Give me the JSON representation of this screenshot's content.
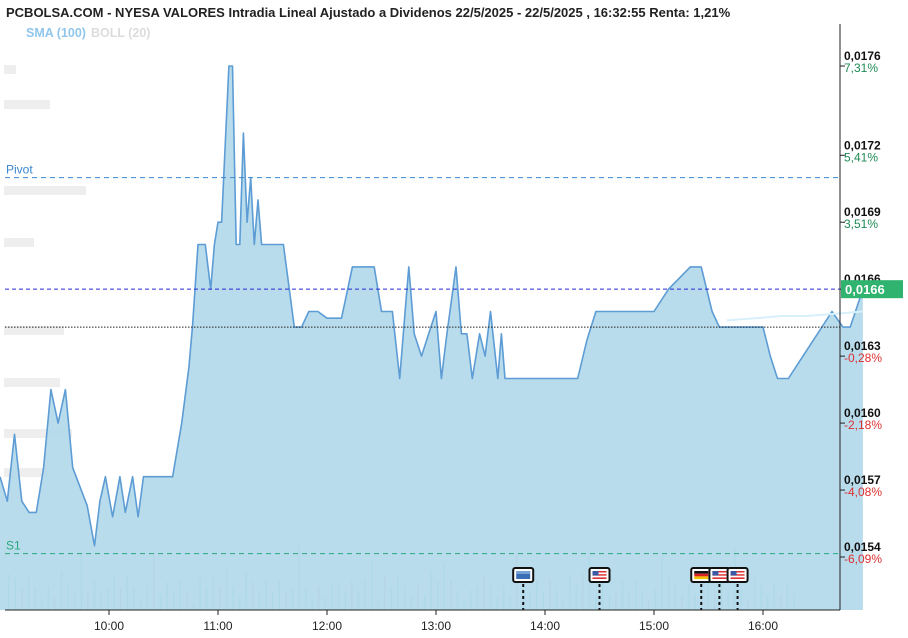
{
  "header": {
    "title": "PCBOLSA.COM - NYESA VALORES Intradia Lineal Ajustado a Dividenos 22/5/2025 - 22/5/2025 , 16:32:55 Renta: 1,21%"
  },
  "legend": {
    "sma": "SMA (100)",
    "boll": "BOLL (20)"
  },
  "colors": {
    "area_fill": "#b0d8ea",
    "line": "#5d9cd4",
    "pivot": "#3b86cf",
    "s1": "#2aa779",
    "current": "#2929d6",
    "positive": "#1e8a55",
    "negative": "#dc3030",
    "badge": "#2fb36f"
  },
  "chart_data": {
    "type": "area",
    "xlabel": "",
    "ylabel": "",
    "ylim": [
      0.01525,
      0.0178
    ],
    "x_ticks": [
      "10:00",
      "11:00",
      "12:00",
      "13:00",
      "14:00",
      "15:00",
      "16:00"
    ],
    "y_ticks": [
      {
        "price": "0,0176",
        "pct": "7,31%",
        "value": 0.0176
      },
      {
        "price": "0,0172",
        "pct": "5,41%",
        "value": 0.0172
      },
      {
        "price": "0,0169",
        "pct": "3,51%",
        "value": 0.0169
      },
      {
        "price": "0,0166",
        "pct": "1,62%",
        "value": 0.0166
      },
      {
        "price": "0,0163",
        "pct": "-0,28%",
        "value": 0.0163
      },
      {
        "price": "0,0160",
        "pct": "-2,18%",
        "value": 0.016
      },
      {
        "price": "0,0157",
        "pct": "-4,08%",
        "value": 0.0157
      },
      {
        "price": "0,0154",
        "pct": "-6,09%",
        "value": 0.0154
      }
    ],
    "series": [
      {
        "values": [
          [
            "09:00",
            0.01576
          ],
          [
            "09:04",
            0.01565
          ],
          [
            "09:08",
            0.01595
          ],
          [
            "09:12",
            0.01565
          ],
          [
            "09:16",
            0.0156
          ],
          [
            "09:20",
            0.0156
          ],
          [
            "09:24",
            0.0158
          ],
          [
            "09:28",
            0.01615
          ],
          [
            "09:32",
            0.016
          ],
          [
            "09:36",
            0.01615
          ],
          [
            "09:40",
            0.0158
          ],
          [
            "09:48",
            0.01563
          ],
          [
            "09:52",
            0.01545
          ],
          [
            "09:55",
            0.01565
          ],
          [
            "09:58",
            0.01576
          ],
          [
            "10:02",
            0.01558
          ],
          [
            "10:06",
            0.01576
          ],
          [
            "10:09",
            0.0156
          ],
          [
            "10:13",
            0.01576
          ],
          [
            "10:16",
            0.01558
          ],
          [
            "10:19",
            0.01576
          ],
          [
            "10:22",
            0.01576
          ],
          [
            "10:35",
            0.01576
          ],
          [
            "10:40",
            0.016
          ],
          [
            "10:44",
            0.01625
          ],
          [
            "10:46",
            0.01644
          ],
          [
            "10:49",
            0.0168
          ],
          [
            "10:53",
            0.0168
          ],
          [
            "10:56",
            0.0166
          ],
          [
            "10:58",
            0.0168
          ],
          [
            "11:00",
            0.0169
          ],
          [
            "11:02",
            0.0169
          ],
          [
            "11:06",
            0.0176
          ],
          [
            "11:08",
            0.0176
          ],
          [
            "11:10",
            0.0168
          ],
          [
            "11:12",
            0.0168
          ],
          [
            "11:14",
            0.0173
          ],
          [
            "11:16",
            0.0169
          ],
          [
            "11:18",
            0.0171
          ],
          [
            "11:20",
            0.0168
          ],
          [
            "11:22",
            0.017
          ],
          [
            "11:24",
            0.0168
          ],
          [
            "11:36",
            0.0168
          ],
          [
            "11:42",
            0.01643
          ],
          [
            "11:46",
            0.01643
          ],
          [
            "11:50",
            0.0165
          ],
          [
            "11:55",
            0.0165
          ],
          [
            "12:00",
            0.01647
          ],
          [
            "12:02",
            0.01647
          ],
          [
            "12:08",
            0.01647
          ],
          [
            "12:14",
            0.0167
          ],
          [
            "12:20",
            0.0167
          ],
          [
            "12:26",
            0.0167
          ],
          [
            "12:30",
            0.0165
          ],
          [
            "12:36",
            0.0165
          ],
          [
            "12:40",
            0.0162
          ],
          [
            "12:43",
            0.0165
          ],
          [
            "12:45",
            0.0167
          ],
          [
            "12:48",
            0.0164
          ],
          [
            "12:52",
            0.0163
          ],
          [
            "12:56",
            0.0164
          ],
          [
            "13:00",
            0.0165
          ],
          [
            "13:03",
            0.0162
          ],
          [
            "13:06",
            0.0164
          ],
          [
            "13:11",
            0.0167
          ],
          [
            "13:14",
            0.0164
          ],
          [
            "13:17",
            0.0164
          ],
          [
            "13:20",
            0.0162
          ],
          [
            "13:24",
            0.0164
          ],
          [
            "13:27",
            0.0163
          ],
          [
            "13:30",
            0.0165
          ],
          [
            "13:34",
            0.0162
          ],
          [
            "13:36",
            0.0164
          ],
          [
            "13:38",
            0.0162
          ],
          [
            "13:43",
            0.0162
          ],
          [
            "13:50",
            0.0162
          ],
          [
            "14:00",
            0.0162
          ],
          [
            "14:10",
            0.0162
          ],
          [
            "14:18",
            0.0162
          ],
          [
            "14:23",
            0.01637
          ],
          [
            "14:28",
            0.0165
          ],
          [
            "14:34",
            0.0165
          ],
          [
            "14:38",
            0.0165
          ],
          [
            "14:48",
            0.0165
          ],
          [
            "15:00",
            0.0165
          ],
          [
            "15:08",
            0.0166
          ],
          [
            "15:20",
            0.0167
          ],
          [
            "15:26",
            0.0167
          ],
          [
            "15:32",
            0.0165
          ],
          [
            "15:36",
            0.01643
          ],
          [
            "15:42",
            0.01643
          ],
          [
            "15:48",
            0.01643
          ],
          [
            "15:55",
            0.01643
          ],
          [
            "16:00",
            0.01643
          ],
          [
            "16:04",
            0.0163
          ],
          [
            "16:08",
            0.0162
          ],
          [
            "16:14",
            0.0162
          ],
          [
            "16:22",
            0.0163
          ],
          [
            "16:30",
            0.0164
          ],
          [
            "16:38",
            0.0165
          ],
          [
            "16:44",
            0.01643
          ],
          [
            "16:48",
            0.01643
          ],
          [
            "16:55",
            0.0166
          ]
        ]
      }
    ],
    "sma_line": [
      [
        "15:40",
        0.01646
      ],
      [
        "15:56",
        0.01647
      ],
      [
        "16:10",
        0.01648
      ],
      [
        "16:24",
        0.01648
      ],
      [
        "16:40",
        0.01649
      ],
      [
        "16:55",
        0.0165
      ]
    ],
    "current": {
      "label": "0,0166",
      "value": 0.0166
    },
    "reference_line": 0.01643,
    "levels": [
      {
        "name": "Pivot",
        "value": 0.0171
      },
      {
        "name": "S1",
        "value": 0.015415
      }
    ],
    "events": [
      {
        "time": "13:48",
        "icon": "ue-flag-icon"
      },
      {
        "time": "14:30",
        "icon": "us-flag-icon"
      },
      {
        "time": "15:26",
        "icon": "de-flag-icon"
      },
      {
        "time": "15:36",
        "icon": "us-flag-icon"
      },
      {
        "time": "15:46",
        "icon": "us-flag-icon"
      }
    ],
    "grid": false,
    "legend_position": "top-left"
  }
}
